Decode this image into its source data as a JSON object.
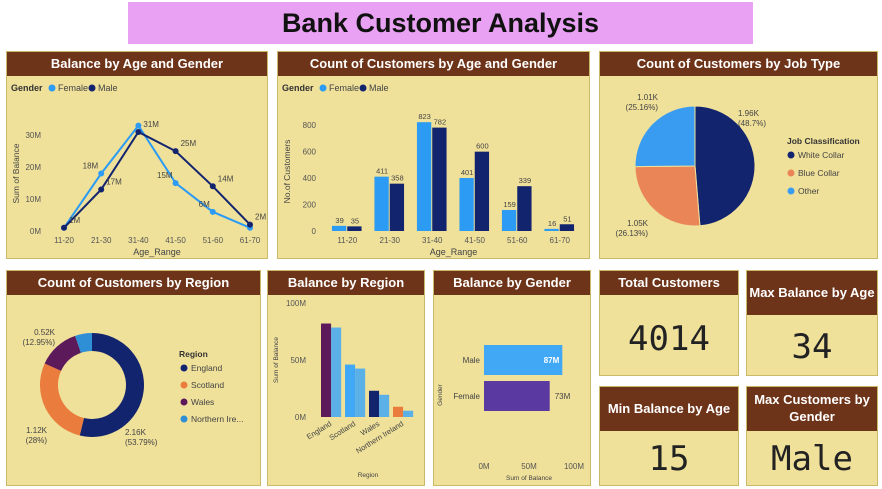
{
  "page_title": "Bank Customer Analysis",
  "colors": {
    "female": "#2b9bf4",
    "male": "#13246e",
    "header": "#6e3419",
    "panel": "#efe09a",
    "blue_collar": "#ea8558",
    "other": "#3a9cf0",
    "scotland": "#ea7d3d",
    "wales": "#5c1a5a",
    "northern_ireland": "#2e8fd6",
    "gender_male_bar": "#41a8f5",
    "gender_female_bar": "#5a3aa0"
  },
  "chart_data": [
    {
      "id": "balance_age_gender",
      "type": "line",
      "title": "Balance by Age and Gender",
      "legend_title": "Gender",
      "xlabel": "Age_Range",
      "ylabel": "Sum of Balance",
      "categories": [
        "11-20",
        "21-30",
        "31-40",
        "41-50",
        "51-60",
        "61-70"
      ],
      "yticks": [
        "0M",
        "10M",
        "20M",
        "30M"
      ],
      "ylim": [
        0,
        36
      ],
      "series": [
        {
          "name": "Female",
          "values": [
            1,
            18,
            33,
            15,
            6,
            1
          ],
          "labels": [
            "",
            "18M",
            "",
            "15M",
            "6M",
            ""
          ]
        },
        {
          "name": "Male",
          "values": [
            1,
            13,
            31,
            25,
            14,
            2
          ],
          "labels": [
            "1M",
            "17M",
            "31M",
            "25M",
            "14M",
            "2M"
          ]
        }
      ]
    },
    {
      "id": "count_age_gender",
      "type": "bar",
      "title": "Count of Customers by Age and Gender",
      "legend_title": "Gender",
      "xlabel": "Age_Range",
      "ylabel": "No.of Customers",
      "categories": [
        "11-20",
        "21-30",
        "31-40",
        "41-50",
        "51-60",
        "61-70"
      ],
      "yticks": [
        "0",
        "200",
        "400",
        "600",
        "800"
      ],
      "ylim": [
        0,
        900
      ],
      "series": [
        {
          "name": "Female",
          "values": [
            39,
            411,
            823,
            401,
            159,
            16
          ]
        },
        {
          "name": "Male",
          "values": [
            35,
            358,
            782,
            600,
            339,
            51
          ]
        }
      ]
    },
    {
      "id": "job_type",
      "type": "pie",
      "title": "Count of Customers by Job Type",
      "legend_title": "Job Classification",
      "slices": [
        {
          "name": "White Collar",
          "value": 1.96,
          "label": "1.96K",
          "pct": "(48.7%)",
          "value_pct": 48.7
        },
        {
          "name": "Blue Collar",
          "value": 1.05,
          "label": "1.05K",
          "pct": "(26.13%)",
          "value_pct": 26.13
        },
        {
          "name": "Other",
          "value": 1.01,
          "label": "1.01K",
          "pct": "(25.16%)",
          "value_pct": 25.16
        }
      ]
    },
    {
      "id": "region_count",
      "type": "pie",
      "title": "Count of Customers by Region",
      "legend_title": "Region",
      "slices": [
        {
          "name": "England",
          "label": "2.16K",
          "pct": "(53.79%)",
          "value_pct": 53.79
        },
        {
          "name": "Scotland",
          "label": "1.12K",
          "pct": "(28%)",
          "value_pct": 28
        },
        {
          "name": "Wales",
          "label": "0.52K",
          "pct": "(12.95%)",
          "value_pct": 12.95
        },
        {
          "name": "Northern Ire...",
          "label": "",
          "pct": "",
          "value_pct": 5.26
        }
      ]
    },
    {
      "id": "balance_region",
      "type": "bar",
      "title": "Balance by Region",
      "xlabel": "Region",
      "ylabel": "Sum of Balance",
      "categories": [
        "England",
        "Scotland",
        "Wales",
        "Northern Ireland"
      ],
      "values": [
        82,
        46,
        23,
        9
      ],
      "yticks": [
        "0M",
        "50M",
        "100M"
      ],
      "ylim": [
        0,
        100
      ]
    },
    {
      "id": "balance_gender",
      "type": "bar",
      "title": "Balance by Gender",
      "xlabel": "Sum of Balance",
      "ylabel": "Gender",
      "categories": [
        "Male",
        "Female"
      ],
      "values": [
        87,
        73
      ],
      "labels": [
        "87M",
        "73M"
      ],
      "xticks": [
        "0M",
        "50M",
        "100M"
      ],
      "xlim": [
        0,
        100
      ]
    }
  ],
  "kpis": {
    "total_customers": {
      "title": "Total Customers",
      "value": "4014"
    },
    "max_balance_age": {
      "title": "Max Balance by Age",
      "value": "34"
    },
    "min_balance_age": {
      "title": "Min Balance by Age",
      "value": "15"
    },
    "max_customers_gender": {
      "title": "Max Customers by Gender",
      "value": "Male"
    }
  }
}
